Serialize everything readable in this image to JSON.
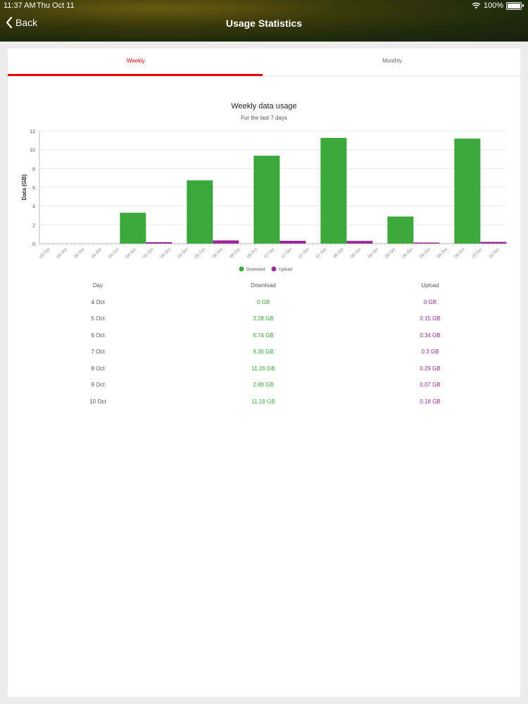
{
  "status_bar": {
    "time": "11:37 AM",
    "date": "Thu Oct 11",
    "battery": "100%"
  },
  "nav": {
    "back_label": "Back",
    "title": "Usage Statistics"
  },
  "tabs": [
    {
      "label": "Weekly",
      "active": true
    },
    {
      "label": "Monthly",
      "active": false
    }
  ],
  "colors": {
    "accent": "#e60000",
    "download": "#3aa83a",
    "upload": "#9b2a9b"
  },
  "chart_data": {
    "type": "bar",
    "title": "Weekly data usage",
    "subtitle": "For the last 7 days",
    "ylabel": "Data (GB)",
    "ylim": [
      0,
      12
    ],
    "yticks": [
      0,
      2,
      4,
      6,
      8,
      10,
      12
    ],
    "grid": true,
    "legend_placement": "bottom",
    "categories": [
      "4 Oct",
      "5 Oct",
      "6 Oct",
      "7 Oct",
      "8 Oct",
      "9 Oct",
      "10 Oct"
    ],
    "series": [
      {
        "name": "Download",
        "values": [
          0,
          3.28,
          6.74,
          9.36,
          11.26,
          2.88,
          11.19
        ]
      },
      {
        "name": "Upload",
        "values": [
          0,
          0.15,
          0.34,
          0.3,
          0.29,
          0.07,
          0.18
        ]
      }
    ],
    "x_tick_labels": [
      "03 Oct",
      "03 Oct",
      "04 Oct",
      "04 Oct",
      "04 Oct",
      "04 Oct",
      "05 Oct",
      "05 Oct",
      "05 Oct",
      "05 Oct",
      "06 Oct",
      "06 Oct",
      "06 Oct",
      "07 Oct",
      "07 Oct",
      "07 Oct",
      "07 Oct",
      "08 Oct",
      "08 Oct",
      "08 Oct",
      "08 Oct",
      "09 Oct",
      "09 Oct",
      "09 Oct",
      "09 Oct",
      "10 Oct",
      "10 Oct"
    ]
  },
  "table": {
    "headers": {
      "day": "Day",
      "download": "Download",
      "upload": "Upload"
    },
    "rows": [
      {
        "day": "4 Oct",
        "download": "0 GB",
        "upload": "0 GB"
      },
      {
        "day": "5 Oct",
        "download": "3.28 GB",
        "upload": "0.15 GB"
      },
      {
        "day": "6 Oct",
        "download": "6.74 GB",
        "upload": "0.34 GB"
      },
      {
        "day": "7 Oct",
        "download": "9.36 GB",
        "upload": "0.3 GB"
      },
      {
        "day": "8 Oct",
        "download": "11.26 GB",
        "upload": "0.29 GB"
      },
      {
        "day": "9 Oct",
        "download": "2.88 GB",
        "upload": "0.07 GB"
      },
      {
        "day": "10 Oct",
        "download": "11.19 GB",
        "upload": "0.18 GB"
      }
    ]
  }
}
